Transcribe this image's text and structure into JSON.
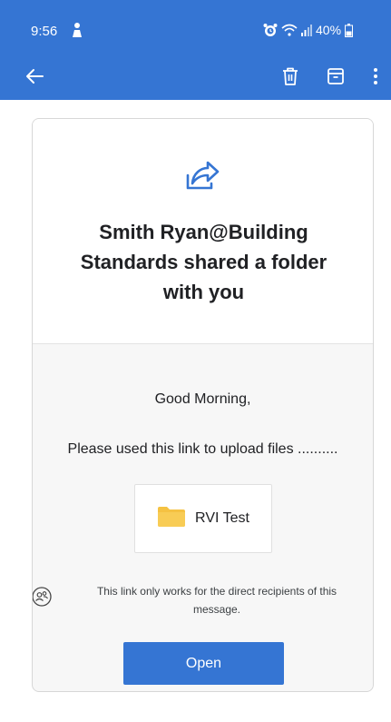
{
  "status_bar": {
    "time": "9:56",
    "battery": "40%",
    "icons": [
      "person-icon",
      "alarm-icon",
      "wifi-icon",
      "signal-icon",
      "battery-icon"
    ]
  },
  "app_bar": {
    "icons": [
      "back-arrow-icon",
      "delete-icon",
      "archive-icon",
      "more-vert-icon"
    ],
    "color": "#3575d3"
  },
  "card": {
    "icon": "share-folder-icon",
    "title": "Smith Ryan@Building Standards shared a folder with you",
    "greeting": "Good Morning,",
    "message": "Please used this link to upload files ..........",
    "folder": {
      "icon": "folder-icon",
      "name": "RVI Test"
    },
    "link_note": "This link only works for the direct recipients of this message.",
    "recipients_icon": "recipients-icon",
    "open_label": "Open"
  },
  "colors": {
    "accent": "#3575d3",
    "folder": "#f5c242"
  }
}
